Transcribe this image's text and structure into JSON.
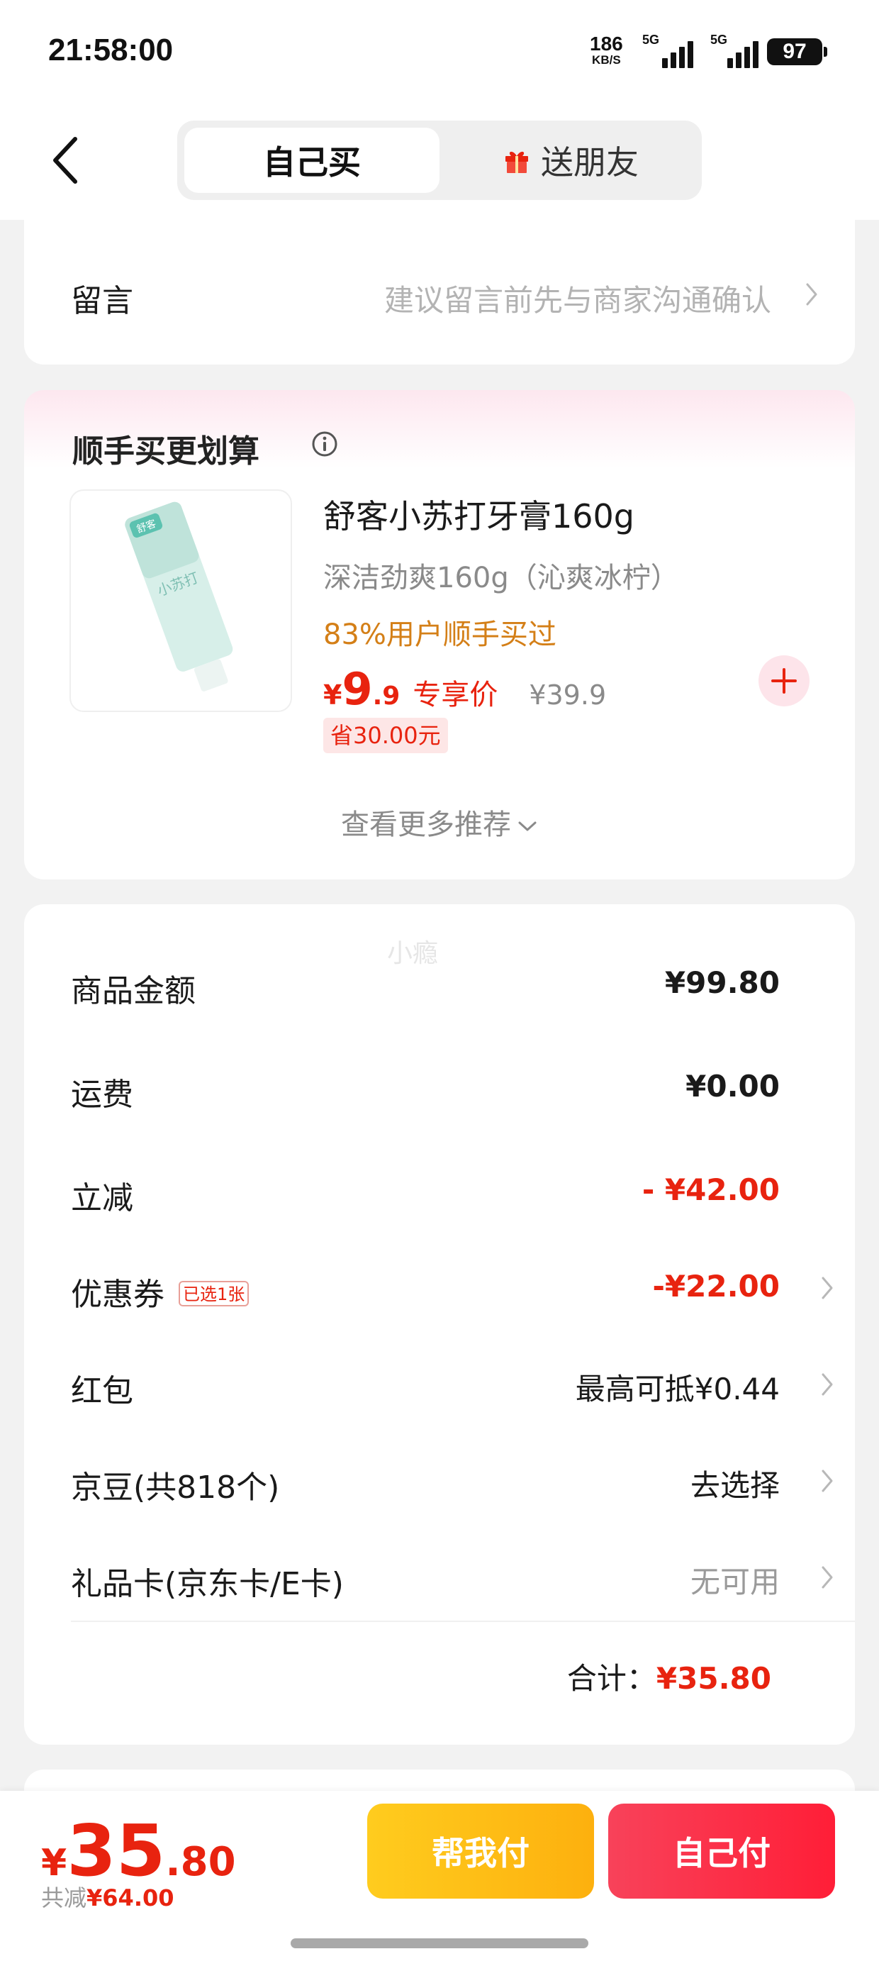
{
  "status_bar": {
    "time": "21:58:00",
    "net_speed": "186",
    "net_unit": "KB/S",
    "signal_1": "5G",
    "signal_2": "5G",
    "battery": "97"
  },
  "nav": {
    "tab_self": "自己买",
    "tab_gift": "送朋友"
  },
  "message": {
    "label": "留言",
    "hint": "建议留言前先与商家沟通确认"
  },
  "recommend": {
    "title": "顺手买更划算",
    "product_name": "舒客小苏打牙膏160g",
    "product_spec": "深洁劲爽160g（沁爽冰柠）",
    "bought_text": "83%用户顺手买过",
    "price_symbol": "¥",
    "price_int": "9",
    "price_dec": ".9",
    "price_tag": "专享价",
    "original_price": "¥39.9",
    "save_text": "省30.00元",
    "more_text": "查看更多推荐",
    "product_image_text": "小苏打",
    "product_brand_text": "舒客"
  },
  "summary": {
    "watermark": "小瘾",
    "rows": [
      {
        "label": "商品金额",
        "value": "¥99.80"
      },
      {
        "label": "运费",
        "value": "¥0.00"
      },
      {
        "label": "立减",
        "value": "- ¥42.00"
      },
      {
        "label": "优惠券",
        "chip": "已选1张",
        "value": "-¥22.00"
      },
      {
        "label": "红包",
        "value": "最高可抵¥0.44"
      },
      {
        "label": "京豆(共818个)",
        "value": "去选择"
      },
      {
        "label": "礼品卡(京东卡/E卡)",
        "value": "无可用"
      }
    ],
    "total_label": "合计：",
    "total_value": "¥35.80"
  },
  "bottom": {
    "price_symbol": "¥",
    "price_int": "35",
    "price_dec": ".80",
    "saved_label": "共减",
    "saved_value": "¥64.00",
    "help_pay": "帮我付",
    "self_pay": "自己付"
  },
  "colors": {
    "accent_red": "#e8230f",
    "orange_text": "#d47f17",
    "help_button": "#fdb00e",
    "pay_button": "#ff1e37"
  },
  "icons": [
    "back-arrow-icon",
    "gift-icon",
    "chevron-right-icon",
    "info-icon",
    "plus-icon",
    "chevron-down-icon",
    "signal-icon",
    "battery-icon"
  ]
}
